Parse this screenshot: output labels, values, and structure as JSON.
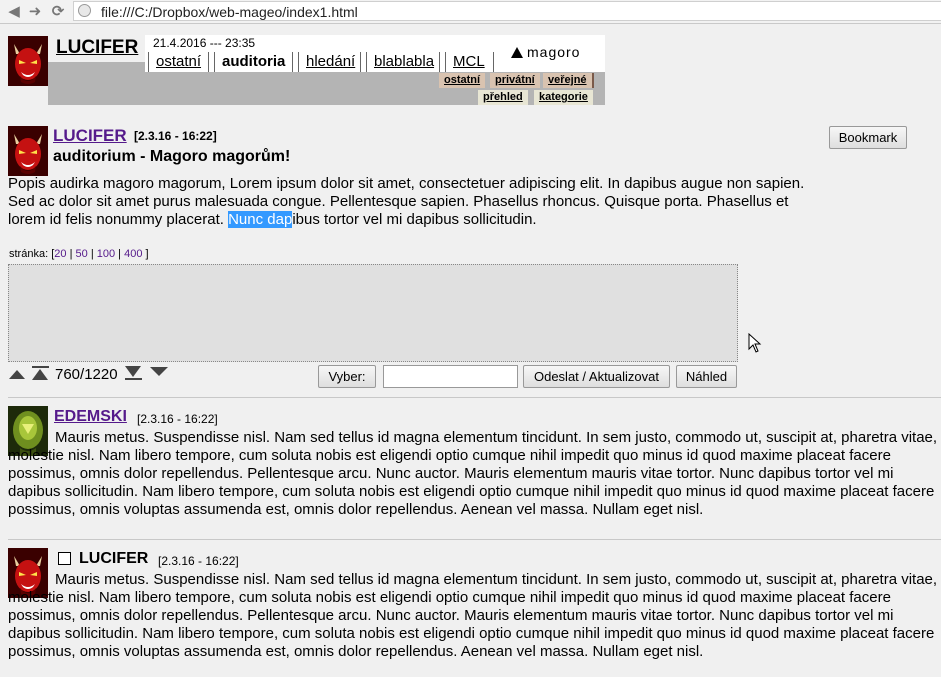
{
  "browser": {
    "url": "file:///C:/Dropbox/web-mageo/index1.html"
  },
  "header": {
    "site_title": "LUCIFER",
    "datetime": "21.4.2016 --- 23:35",
    "tabs": [
      {
        "label": "ostatní"
      },
      {
        "label": "auditoria",
        "active": true
      },
      {
        "label": "hledání"
      },
      {
        "label": "blablabla"
      },
      {
        "label": "MCL"
      }
    ],
    "logo_text": "magoro",
    "subtabs_row1": [
      "ostatní",
      "privátní",
      "veřejné"
    ],
    "subtabs_row2": [
      "přehled",
      "kategorie"
    ]
  },
  "main_post": {
    "author": "LUCIFER",
    "date": "[2.3.16 - 16:22]",
    "subject": "auditorium - Magoro magorům!",
    "body_before": "Popis audirka magoro magorum, Lorem ipsum dolor sit amet, consectetuer adipiscing elit. In dapibus augue non sapien. Sed ac dolor sit amet purus malesuada congue. Pellentesque sapien. Phasellus rhoncus. Quisque porta. Phasellus et lorem id felis nonummy placerat. ",
    "body_highlight": "Nunc dap",
    "body_after": "ibus tortor vel mi dapibus sollicitudin.",
    "bookmark_label": "Bookmark"
  },
  "composer": {
    "pager_label": "stránka:",
    "pager_open": "[",
    "pager_close": "]",
    "pager_sep": "|",
    "pager_options": [
      "20",
      "50",
      "100",
      "400"
    ],
    "counter": "760/1220",
    "select_label": "Vyber:",
    "input_value": "",
    "send_label": "Odeslat / Aktualizovat",
    "preview_label": "Náhled"
  },
  "entries": [
    {
      "author": "EDEMSKI",
      "date": "[2.3.16 - 16:22]",
      "body": "Mauris metus. Suspendisse nisl. Nam sed tellus id magna elementum tincidunt. In sem justo, commodo ut, suscipit at, pharetra vitae, molestie nisl. Nam libero tempore, cum soluta nobis est eligendi optio cumque nihil impedit quo minus id quod maxime placeat facere possimus, omnis dolor repellendus. Pellentesque arcu. Nunc auctor. Mauris elementum mauris vitae tortor. Nunc dapibus tortor vel mi dapibus sollicitudin. Nam libero tempore, cum soluta nobis est eligendi optio cumque nihil impedit quo minus id quod maxime placeat facere possimus, omnis voluptas assumenda est, omnis dolor repellendus. Aenean vel massa. Nullam eget nisl."
    },
    {
      "author": "LUCIFER",
      "date": "[2.3.16 - 16:22]",
      "body": "Mauris metus. Suspendisse nisl. Nam sed tellus id magna elementum tincidunt. In sem justo, commodo ut, suscipit at, pharetra vitae, molestie nisl. Nam libero tempore, cum soluta nobis est eligendi optio cumque nihil impedit quo minus id quod maxime placeat facere possimus, omnis dolor repellendus. Pellentesque arcu. Nunc auctor. Mauris elementum mauris vitae tortor. Nunc dapibus tortor vel mi dapibus sollicitudin. Nam libero tempore, cum soluta nobis est eligendi optio cumque nihil impedit quo minus id quod maxime placeat facere possimus, omnis voluptas assumenda est, omnis dolor repellendus. Aenean vel massa. Nullam eget nisl."
    }
  ],
  "colors": {
    "accent_link": "#551a8b",
    "selection": "#3399ff",
    "header_gray": "#b4b4b4",
    "subtab_bg": "#d9c3b0"
  },
  "icons": [
    "back-icon",
    "forward-icon",
    "reload-icon",
    "page-icon",
    "devil-avatar-icon",
    "alien-avatar-icon",
    "scroll-up-icon",
    "scroll-top-icon",
    "scroll-bottom-icon",
    "scroll-down-icon",
    "mouse-cursor-icon"
  ]
}
